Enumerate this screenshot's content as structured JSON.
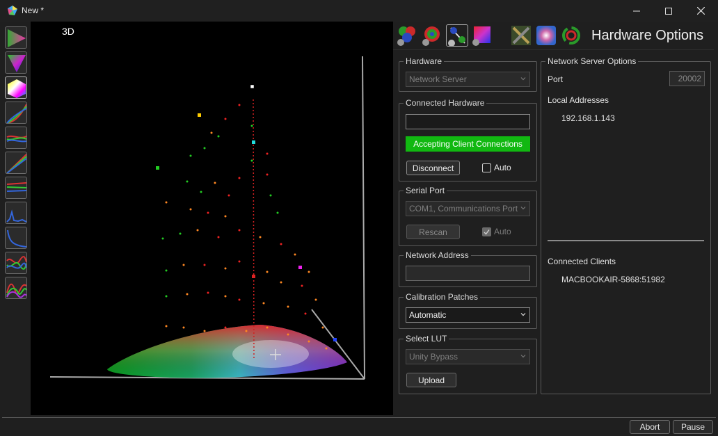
{
  "window": {
    "title": "New *"
  },
  "viewport": {
    "label": "3D"
  },
  "panel": {
    "heading": "Hardware Options"
  },
  "hardware": {
    "group_title": "Hardware",
    "selected": "Network Server"
  },
  "connected_hardware": {
    "group_title": "Connected Hardware",
    "value": "",
    "status": "Accepting Client Connections",
    "status_color": "#11b811",
    "disconnect_label": "Disconnect",
    "auto_label": "Auto",
    "auto_checked": false
  },
  "serial_port": {
    "group_title": "Serial Port",
    "selected": "COM1, Communications Port",
    "rescan_label": "Rescan",
    "auto_label": "Auto",
    "auto_checked": true
  },
  "network_address": {
    "group_title": "Network Address",
    "value": ""
  },
  "calibration_patches": {
    "group_title": "Calibration Patches",
    "selected": "Automatic"
  },
  "select_lut": {
    "group_title": "Select LUT",
    "selected": "Unity Bypass",
    "upload_label": "Upload"
  },
  "network_server_options": {
    "group_title": "Network Server Options",
    "port_label": "Port",
    "port_value": "20002",
    "local_addresses_label": "Local Addresses",
    "local_addresses": [
      "192.168.1.143"
    ],
    "connected_clients_label": "Connected Clients",
    "connected_clients": [
      "MACBOOKAIR-5868:51982"
    ]
  },
  "footer": {
    "abort_label": "Abort",
    "pause_label": "Pause"
  }
}
